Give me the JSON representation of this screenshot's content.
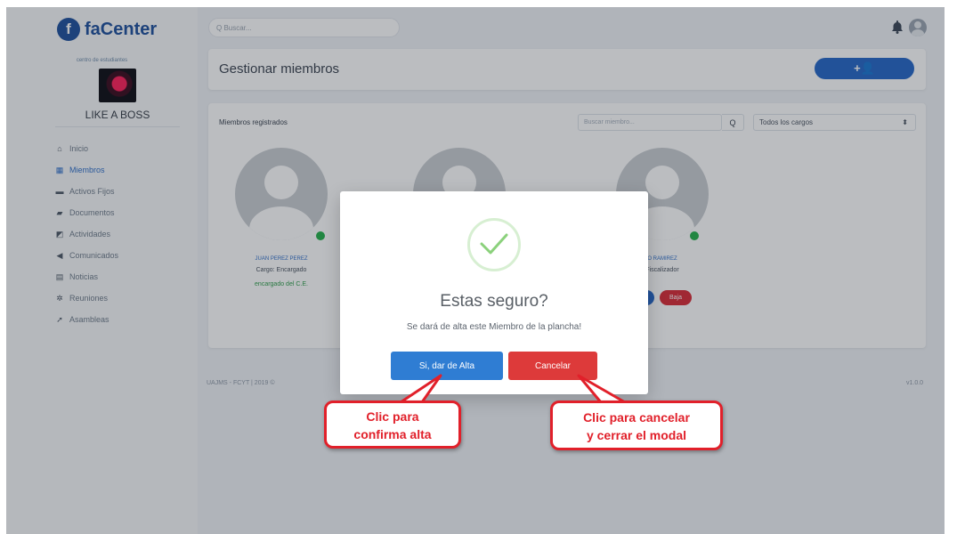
{
  "brand": {
    "logo_letter": "f",
    "name": "faCenter"
  },
  "organization": {
    "subtitle": "centro de estudiantes",
    "name": "LIKE A BOSS"
  },
  "sidebar": {
    "items": [
      {
        "label": "Inicio",
        "icon": "home-icon",
        "glyph": "⌂",
        "active": false
      },
      {
        "label": "Miembros",
        "icon": "members-icon",
        "glyph": "▦",
        "active": true
      },
      {
        "label": "Activos Fijos",
        "icon": "assets-icon",
        "glyph": "▬",
        "active": false
      },
      {
        "label": "Documentos",
        "icon": "folder-icon",
        "glyph": "▰",
        "active": false
      },
      {
        "label": "Actividades",
        "icon": "activities-icon",
        "glyph": "◩",
        "active": false
      },
      {
        "label": "Comunicados",
        "icon": "megaphone-icon",
        "glyph": "◀",
        "active": false
      },
      {
        "label": "Noticias",
        "icon": "news-icon",
        "glyph": "▤",
        "active": false
      },
      {
        "label": "Reuniones",
        "icon": "meeting-icon",
        "glyph": "✲",
        "active": false
      },
      {
        "label": "Asambleas",
        "icon": "gavel-icon",
        "glyph": "➚",
        "active": false
      }
    ]
  },
  "topbar": {
    "search_placeholder": "Q Buscar..."
  },
  "header": {
    "title": "Gestionar miembros",
    "add_button": "+👤"
  },
  "members": {
    "title": "Miembros registrados",
    "search_placeholder": "Buscar miembro...",
    "search_button": "Q",
    "filter_selected": "Todos los cargos",
    "filter_caret": "⬍",
    "list": [
      {
        "name": "JUAN PEREZ PEREZ",
        "cargo": "Cargo: Encargado",
        "role": "encargado del C.E."
      },
      {
        "name": "",
        "cargo": "",
        "role": ""
      },
      {
        "name": "O RAMIREZ",
        "cargo": "Fiscalizador",
        "role": "",
        "action": "Baja"
      }
    ]
  },
  "footer": {
    "left": "UAJMS - FCYT | 2019 ©",
    "right": "v1.0.0"
  },
  "modal": {
    "title": "Estas seguro?",
    "message": "Se dará de alta este Miembro de la plancha!",
    "confirm_label": "Si, dar de Alta",
    "cancel_label": "Cancelar"
  },
  "annotations": {
    "confirm": {
      "line1": "Clic para",
      "line2": "confirma alta"
    },
    "cancel": {
      "line1": "Clic para cancelar",
      "line2": "y cerrar el modal"
    }
  },
  "colors": {
    "primary": "#2466c7",
    "danger": "#dd3a3a",
    "success": "#24b14b",
    "callout": "#e1202a"
  }
}
